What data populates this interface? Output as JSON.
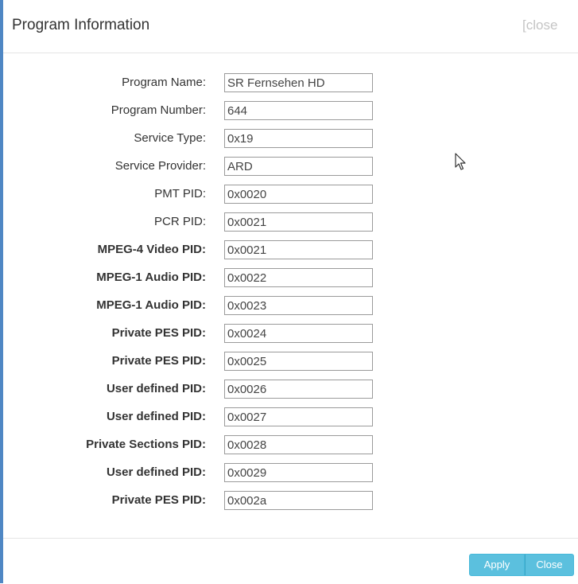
{
  "dialog": {
    "title": "Program Information",
    "close_link": "[close"
  },
  "fields": [
    {
      "label": "Program Name:",
      "value": "SR Fernsehen HD",
      "bold": false
    },
    {
      "label": "Program Number:",
      "value": "644",
      "bold": false
    },
    {
      "label": "Service Type:",
      "value": "0x19",
      "bold": false
    },
    {
      "label": "Service Provider:",
      "value": "ARD",
      "bold": false
    },
    {
      "label": "PMT PID:",
      "value": "0x0020",
      "bold": false
    },
    {
      "label": "PCR PID:",
      "value": "0x0021",
      "bold": false
    },
    {
      "label": "MPEG-4 Video PID:",
      "value": "0x0021",
      "bold": true
    },
    {
      "label": "MPEG-1 Audio PID:",
      "value": "0x0022",
      "bold": true
    },
    {
      "label": "MPEG-1 Audio PID:",
      "value": "0x0023",
      "bold": true
    },
    {
      "label": "Private PES PID:",
      "value": "0x0024",
      "bold": true
    },
    {
      "label": "Private PES PID:",
      "value": "0x0025",
      "bold": true
    },
    {
      "label": "User defined PID:",
      "value": "0x0026",
      "bold": true
    },
    {
      "label": "User defined PID:",
      "value": "0x0027",
      "bold": true
    },
    {
      "label": "Private Sections PID:",
      "value": "0x0028",
      "bold": true
    },
    {
      "label": "User defined PID:",
      "value": "0x0029",
      "bold": true
    },
    {
      "label": "Private PES PID:",
      "value": "0x002a",
      "bold": true
    }
  ],
  "footer": {
    "apply_label": "Apply",
    "close_label": "Close"
  },
  "colors": {
    "accent_blue": "#4f87c4",
    "button_info": "#5bc0de"
  }
}
